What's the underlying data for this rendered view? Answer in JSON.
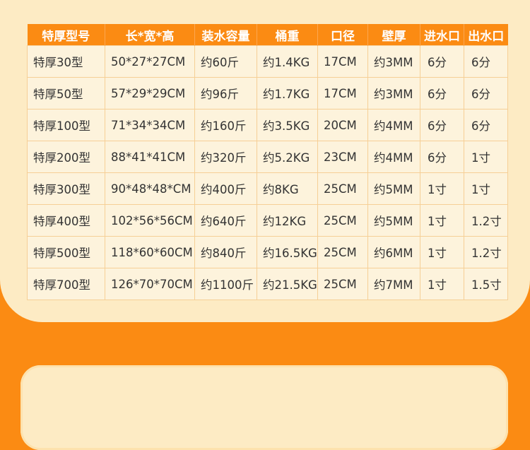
{
  "table": {
    "headers": [
      "特厚型号",
      "长*宽*高",
      "装水容量",
      "桶重",
      "口径",
      "壁厚",
      "进水口",
      "出水口"
    ],
    "rows": [
      {
        "model": "特厚30型",
        "dimensions": "50*27*27CM",
        "capacity": "约60斤",
        "weight": "约1.4KG",
        "caliber": "17CM",
        "wall": "约3MM",
        "inlet": "6分",
        "outlet": "6分"
      },
      {
        "model": "特厚50型",
        "dimensions": "57*29*29CM",
        "capacity": "约96斤",
        "weight": "约1.7KG",
        "caliber": "17CM",
        "wall": "约3MM",
        "inlet": "6分",
        "outlet": "6分"
      },
      {
        "model": "特厚100型",
        "dimensions": "71*34*34CM",
        "capacity": "约160斤",
        "weight": "约3.5KG",
        "caliber": "20CM",
        "wall": "约4MM",
        "inlet": "6分",
        "outlet": "6分"
      },
      {
        "model": "特厚200型",
        "dimensions": "88*41*41CM",
        "capacity": "约320斤",
        "weight": "约5.2KG",
        "caliber": "23CM",
        "wall": "约4MM",
        "inlet": "6分",
        "outlet": "1寸"
      },
      {
        "model": "特厚300型",
        "dimensions": "90*48*48*CM",
        "capacity": "约400斤",
        "weight": "约8KG",
        "caliber": "25CM",
        "wall": "约5MM",
        "inlet": "1寸",
        "outlet": "1寸"
      },
      {
        "model": "特厚400型",
        "dimensions": "102*56*56CM",
        "capacity": "约640斤",
        "weight": "约12KG",
        "caliber": "25CM",
        "wall": "约5MM",
        "inlet": "1寸",
        "outlet": "1.2寸"
      },
      {
        "model": "特厚500型",
        "dimensions": "118*60*60CM",
        "capacity": "约840斤",
        "weight": "约16.5KG",
        "caliber": "25CM",
        "wall": "约6MM",
        "inlet": "1寸",
        "outlet": "1.2寸"
      },
      {
        "model": "特厚700型",
        "dimensions": "126*70*70CM",
        "capacity": "约1100斤",
        "weight": "约21.5KG",
        "caliber": "25CM",
        "wall": "约7MM",
        "inlet": "1寸",
        "outlet": "1.5寸"
      }
    ]
  },
  "colors": {
    "accent": "#fb8b13",
    "panel": "#fdebc4",
    "cell": "#fdf3dc",
    "border": "#f6cf96"
  }
}
